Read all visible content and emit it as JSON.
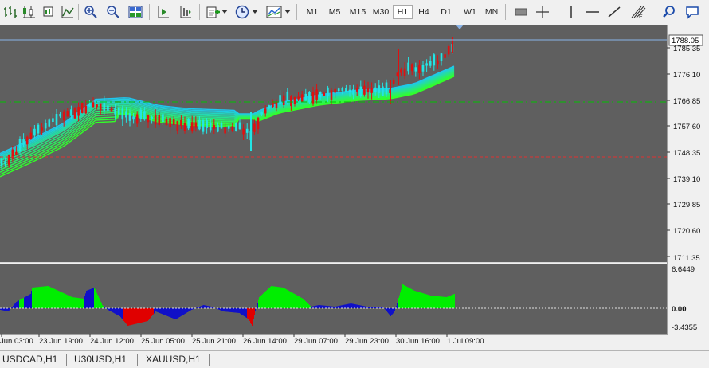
{
  "toolbar": {
    "timeframes": [
      "M1",
      "M5",
      "M15",
      "M30",
      "H1",
      "H4",
      "D1",
      "W1",
      "MN"
    ],
    "active_timeframe": "H1"
  },
  "price_axis": {
    "current_price": "1788.05",
    "labels": [
      "1785.35",
      "1776.10",
      "1766.85",
      "1757.60",
      "1748.35",
      "1739.10",
      "1729.85",
      "1720.60",
      "1711.35"
    ]
  },
  "indicator_axis": {
    "labels": [
      "6.6449",
      "0.00",
      "-3.4355"
    ]
  },
  "time_axis": {
    "labels": [
      "Jun 03:00",
      "23 Jun 19:00",
      "24 Jun 12:00",
      "25 Jun 05:00",
      "25 Jun 21:00",
      "26 Jun 14:00",
      "29 Jun 07:00",
      "29 Jun 23:00",
      "30 Jun 16:00",
      "1 Jul 09:00"
    ]
  },
  "symbol_tabs": [
    "USDCAD,H1",
    "U30USD,H1",
    "XAUUSD,H1"
  ],
  "colors": {
    "chart_bg": "#5f5f5f",
    "bull_candle": "#22e5e5",
    "bear_candle": "#e01010",
    "level_green": "#00c000",
    "level_red": "#e03030",
    "histogram_green": "#00ee00",
    "histogram_blue": "#1010c8",
    "histogram_red": "#e00000"
  }
}
